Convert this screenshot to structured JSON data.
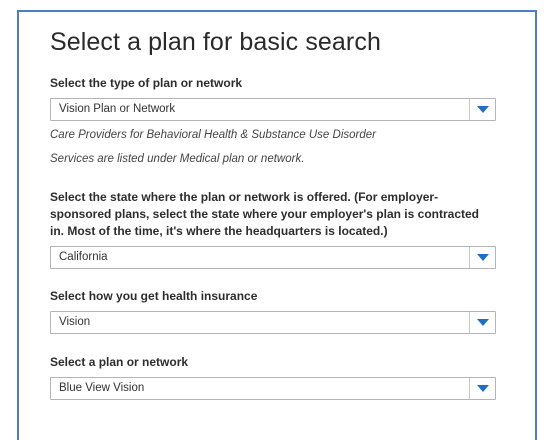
{
  "page": {
    "title": "Select a plan for basic search"
  },
  "plan_type": {
    "label": "Select the type of plan or network",
    "value": "Vision Plan or Network",
    "note_line1": "Care Providers for Behavioral Health & Substance Use Disorder",
    "note_line2": "Services are listed under Medical plan or network."
  },
  "state": {
    "label": "Select the state where the plan or network is offered. (For employer-sponsored plans, select the state where your employer's plan is contracted in. Most of the time, it's where the headquarters is located.)",
    "value": "California"
  },
  "insurance_source": {
    "label": "Select how you get health insurance",
    "value": "Vision"
  },
  "plan": {
    "label": "Select a plan or network",
    "value": "Blue View Vision"
  },
  "colors": {
    "accent": "#1f6fc5",
    "panel_border": "#4a7fc1"
  },
  "icons": {
    "dropdown": "chevron-down-icon"
  }
}
